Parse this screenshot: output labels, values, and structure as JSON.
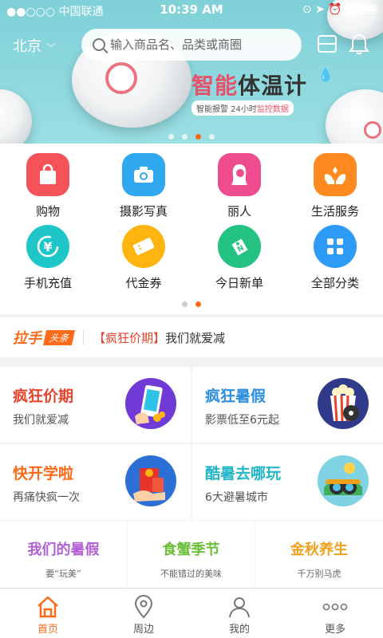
{
  "status_bar": {
    "carrier": "●●○○○ 中国联通",
    "time": "10:39 AM"
  },
  "header": {
    "city": "北京",
    "search_placeholder": "输入商品名、品类或商圈"
  },
  "banner": {
    "title_highlight": "智能",
    "title_rest": "体温计",
    "subtitle_plain": "智能报警  24小时",
    "subtitle_highlight": "监控数据",
    "active_index": 2
  },
  "categories": [
    {
      "label": "购物",
      "icon": "shopping-bag-icon",
      "color": "#f5525a"
    },
    {
      "label": "摄影写真",
      "icon": "camera-icon",
      "color": "#2fa8f0"
    },
    {
      "label": "丽人",
      "icon": "woman-icon",
      "color": "#ef4c8f"
    },
    {
      "label": "生活服务",
      "icon": "hands-care-icon",
      "color": "#ff8a1f"
    },
    {
      "label": "手机充值",
      "icon": "yen-recharge-icon",
      "color": "#1ec6c8"
    },
    {
      "label": "代金券",
      "icon": "ticket-icon",
      "color": "#ffb40f"
    },
    {
      "label": "今日新单",
      "icon": "new-tag-icon",
      "color": "#23c282"
    },
    {
      "label": "全部分类",
      "icon": "grid-all-icon",
      "color": "#2e9bf6"
    }
  ],
  "category_pages_active": 1,
  "headline": {
    "logo": "拉手",
    "tag": "头条",
    "bracket": "【疯狂价期】",
    "text": "我们就爱减"
  },
  "promos": [
    {
      "title": "疯狂价期",
      "subtitle": "我们就爱减",
      "color": "#e8432d",
      "art": "phone-coupon-illustration"
    },
    {
      "title": "疯狂暑假",
      "subtitle": "影票低至6元起",
      "color": "#2b8de0",
      "art": "popcorn-film-illustration"
    },
    {
      "title": "快开学啦",
      "subtitle": "再痛快疯一次",
      "color": "#ff6a1a",
      "art": "red-envelope-illustration"
    },
    {
      "title": "酷暑去哪玩",
      "subtitle": "6大避暑城市",
      "color": "#21b6c7",
      "art": "binoculars-illustration"
    }
  ],
  "seasons": [
    {
      "title": "我们的暑假",
      "subtitle": "要“玩美”",
      "color": "#b25fd6"
    },
    {
      "title": "食蟹季节",
      "subtitle": "不能错过的美味",
      "color": "#6cbf3a"
    },
    {
      "title": "金秋养生",
      "subtitle": "千万别马虎",
      "color": "#f0a11c"
    }
  ],
  "tabs": [
    {
      "label": "首页",
      "icon": "home-icon"
    },
    {
      "label": "周边",
      "icon": "location-pin-icon"
    },
    {
      "label": "我的",
      "icon": "user-icon"
    },
    {
      "label": "更多",
      "icon": "more-dots-icon"
    }
  ],
  "active_tab": 0
}
